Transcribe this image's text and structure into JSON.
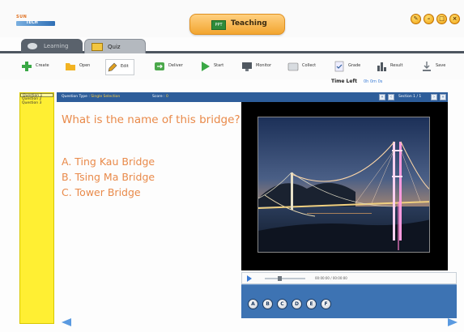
{
  "app": {
    "logo_top": "SUN",
    "logo_bottom": "TECH",
    "mode_label": "Teaching",
    "mode_icon_text": "PPT",
    "window_controls": [
      "settings-icon",
      "minimize-icon",
      "maximize-icon",
      "close-icon"
    ]
  },
  "tabs": [
    {
      "label": "Learning",
      "icon": "graduation-cap-icon"
    },
    {
      "label": "Quiz",
      "icon": "quiz-icon"
    }
  ],
  "toolbar": [
    {
      "label": "Create",
      "icon": "plus-icon"
    },
    {
      "label": "Open",
      "icon": "folder-icon"
    },
    {
      "label": "Edit",
      "icon": "pencil-icon"
    },
    {
      "label": "Deliver",
      "icon": "deliver-icon"
    },
    {
      "label": "Start",
      "icon": "play-icon"
    },
    {
      "label": "Monitor",
      "icon": "monitor-icon"
    },
    {
      "label": "Collect",
      "icon": "collect-icon"
    },
    {
      "label": "Grade",
      "icon": "grade-icon"
    },
    {
      "label": "Result",
      "icon": "bar-chart-icon"
    },
    {
      "label": "Save",
      "icon": "save-icon"
    }
  ],
  "timer": {
    "label": "Time Left",
    "value": "0h 0m 0s"
  },
  "questions": [
    "Question 1",
    "Question 2",
    "Question 3"
  ],
  "selected_question": 0,
  "header": {
    "type_label": "Question Type :",
    "type_value": "Single Selection",
    "score_label": "Score :",
    "score_value": "0",
    "section": "Section 1 / 1"
  },
  "question_text": "What is the name of this bridge?",
  "options": [
    "A. Ting Kau Bridge",
    "B. Tsing Ma Bridge",
    "C. Tower Bridge"
  ],
  "media": {
    "time": "00:00:00 / 00:00:00"
  },
  "answer_buttons": [
    "A",
    "B",
    "C",
    "D",
    "E",
    "F"
  ],
  "colors": {
    "accent": "#2d5d9a",
    "question_text": "#e98a4a",
    "question_list_bg": "#ffef33",
    "answer_panel": "#3d73b3"
  }
}
